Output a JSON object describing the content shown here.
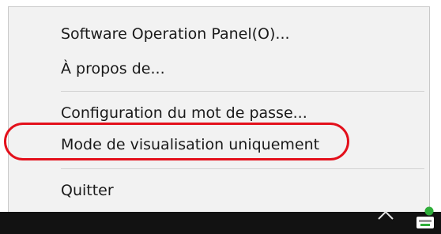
{
  "menu": {
    "items": [
      {
        "label": "Software Operation Panel(O)..."
      },
      {
        "label": "À propos de..."
      },
      {
        "label": "Configuration du mot de passe..."
      },
      {
        "label": "Mode de visualisation uniquement"
      },
      {
        "label": "Quitter"
      }
    ],
    "highlighted_item": "Mode de visualisation uniquement",
    "highlight_color": "#e3101b"
  },
  "taskbar": {
    "icons": [
      "chevron-up-icon",
      "scanner-tray-icon"
    ],
    "tray_icon_color": "#2fae3a"
  }
}
